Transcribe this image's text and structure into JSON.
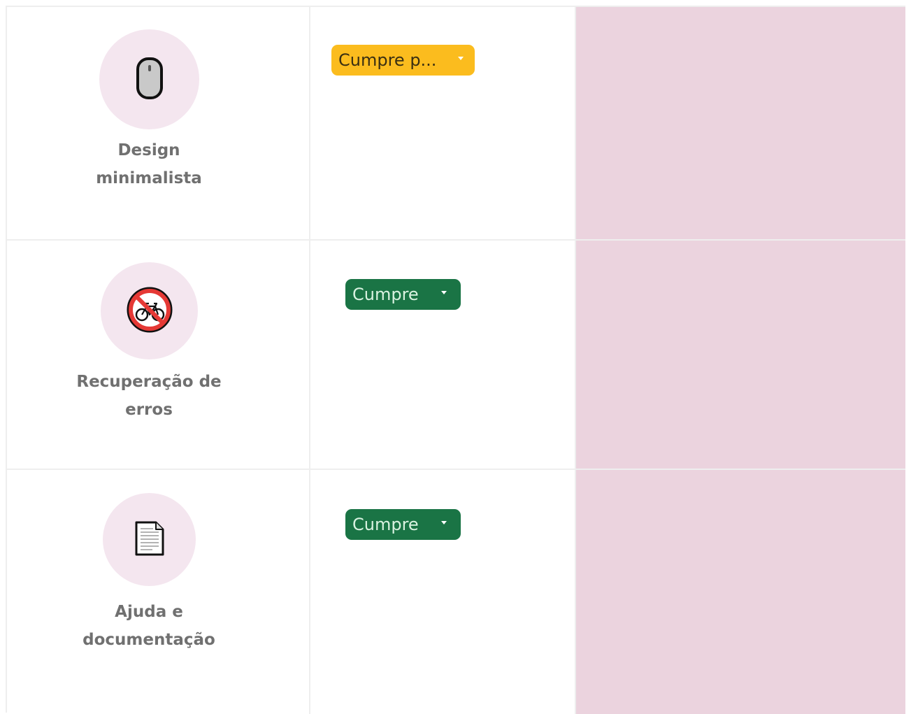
{
  "colors": {
    "circle_bg": "#f4e6ef",
    "notes_bg": "#ebd3de",
    "partial_badge": "#fbbc1e",
    "ok_badge": "#1a7445",
    "label_text": "#707070"
  },
  "rows": [
    {
      "icon": "computer-mouse-icon",
      "label_lines": [
        "Design",
        "minimalista"
      ],
      "status": "Cumpre p..."
    },
    {
      "icon": "no-bicycles-icon",
      "label_lines": [
        "Recuperação de",
        "erros"
      ],
      "status": "Cumpre"
    },
    {
      "icon": "page-document-icon",
      "label_lines": [
        "Ajuda e",
        "documentação"
      ],
      "status": "Cumpre"
    }
  ]
}
